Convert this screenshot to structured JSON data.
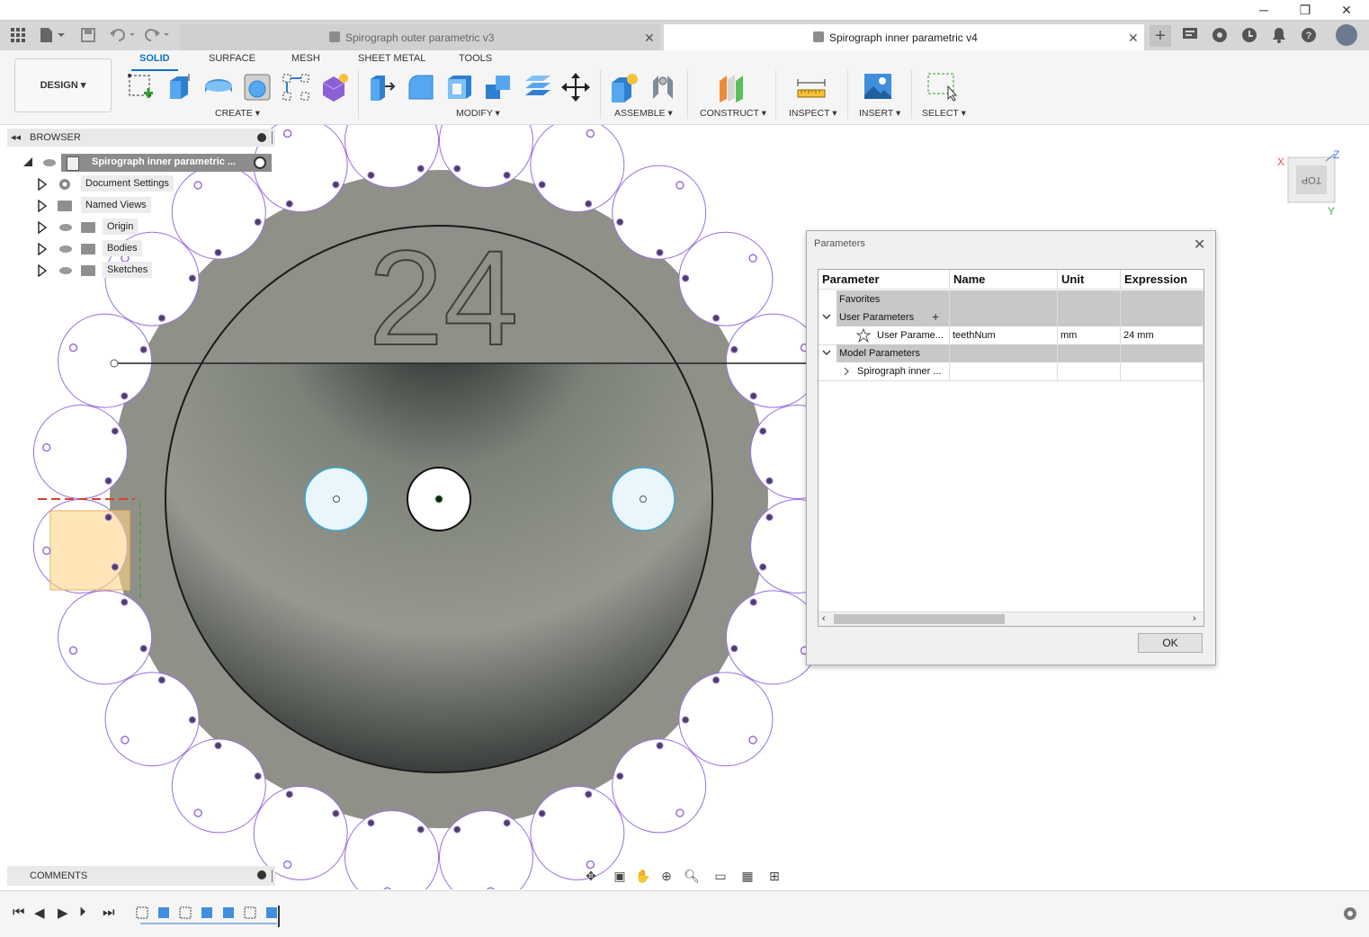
{
  "window": {
    "minimize": "─",
    "maximize": "❐",
    "close": "✕"
  },
  "tabs": [
    {
      "label": "Spirograph outer parametric v3",
      "close": "✕"
    },
    {
      "label": "Spirograph inner parametric v4",
      "close": "✕"
    }
  ],
  "toolbar": {
    "workspace": "DESIGN ▾",
    "menu_tabs": [
      "SOLID",
      "SURFACE",
      "MESH",
      "SHEET METAL",
      "TOOLS"
    ],
    "groups": [
      "CREATE ▾",
      "MODIFY ▾",
      "ASSEMBLE ▾",
      "CONSTRUCT ▾",
      "INSPECT ▾",
      "INSERT ▾",
      "SELECT ▾"
    ]
  },
  "browser": {
    "title": "BROWSER",
    "root": "Spirograph inner parametric ...",
    "items": [
      "Document Settings",
      "Named Views",
      "Origin",
      "Bodies",
      "Sketches"
    ]
  },
  "comments": {
    "title": "COMMENTS"
  },
  "canvas": {
    "engraving": "24",
    "viewcube_label": "TOP",
    "axis_x": "X",
    "axis_y": "Y",
    "axis_z": "Z"
  },
  "dialog": {
    "title": "Parameters",
    "columns": [
      "Parameter",
      "Name",
      "Unit",
      "Expression"
    ],
    "rows": {
      "favorites": "Favorites",
      "user_params": "User Parameters",
      "user_param_row": {
        "parameter": "User Parame...",
        "name": "teethNum",
        "unit": "mm",
        "expression": "24 mm"
      },
      "model_params": "Model Parameters",
      "model_child": "Spirograph inner ..."
    },
    "ok": "OK"
  },
  "colors": {
    "accent": "#0b73c4",
    "gear_fill": "#8f9188",
    "sketch_purple": "#9b6ee0",
    "selection": "#ffd58a"
  }
}
